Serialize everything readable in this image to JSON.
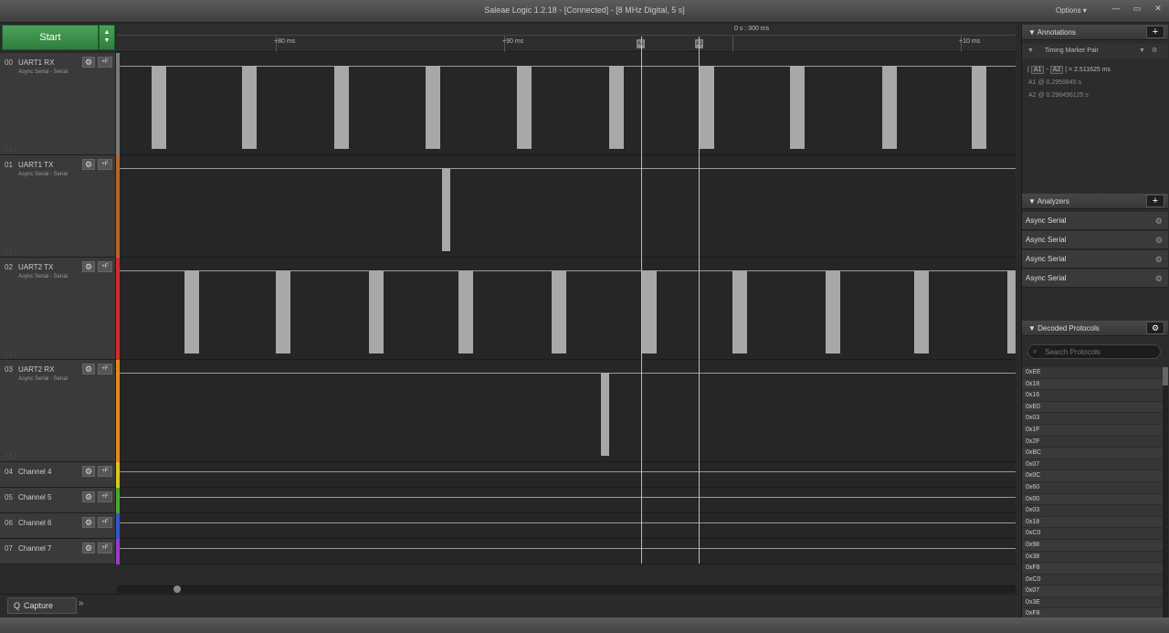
{
  "window": {
    "title": "Saleae Logic 1.2.18 - [Connected] - [8 MHz Digital, 5 s]",
    "options_label": "Options ▾",
    "minimize_glyph": "—",
    "restore_glyph": "▭",
    "close_glyph": "✕"
  },
  "toolbar": {
    "start_label": "Start",
    "arrows_glyph": "▲▼"
  },
  "ruler": {
    "absolute_time": "0 s : 300 ms",
    "ticks": [
      "+80 ms",
      "+90 ms",
      "+10 ms"
    ],
    "marker_a1": "A1",
    "marker_a2": "A2"
  },
  "channels": [
    {
      "num": "00",
      "name": "UART1 RX",
      "sub": "Async Serial - Serial",
      "color": "#7a7a7a"
    },
    {
      "num": "01",
      "name": "UART1 TX",
      "sub": "Async Serial - Serial",
      "color": "#b5652b"
    },
    {
      "num": "02",
      "name": "UART2 TX",
      "sub": "Async Serial - Serial",
      "color": "#d12b2b"
    },
    {
      "num": "03",
      "name": "UART2 RX",
      "sub": "Async Serial - Serial",
      "color": "#e08a1e"
    },
    {
      "num": "04",
      "name": "Channel 4",
      "sub": "",
      "color": "#d8c81e"
    },
    {
      "num": "05",
      "name": "Channel 5",
      "sub": "",
      "color": "#47a82f"
    },
    {
      "num": "06",
      "name": "Channel 6",
      "sub": "",
      "color": "#3358c9"
    },
    {
      "num": "07",
      "name": "Channel 7",
      "sub": "",
      "color": "#9a3bc4"
    }
  ],
  "channel_controls": {
    "gear_glyph": "⚙",
    "plus_glyph": "+F",
    "grip_glyph": "⋮⋮⋮"
  },
  "annotations": {
    "header": "Annotations",
    "add_glyph": "+",
    "filter_glyph": "▼",
    "marker_pair_label": "Timing Marker Pair",
    "dropdown_glyph": "▼",
    "gear_glyph": "⚙",
    "a1": "A1",
    "a2": "A2",
    "delta_prefix": "|",
    "delta_mid": "-",
    "delta_suffix": "| = 2.511625 ms",
    "a1_line": "A1  @  0.2959845 s",
    "a2_line": "A2  @  0.298496125 s"
  },
  "analyzers": {
    "header": "Analyzers",
    "add_glyph": "+",
    "gear_glyph": "⚙",
    "items": [
      "Async Serial",
      "Async Serial",
      "Async Serial",
      "Async Serial"
    ]
  },
  "decoded": {
    "header": "Decoded Protocols",
    "gear_glyph": "⚙",
    "search_icon": "⌕",
    "search_placeholder": "Search Protocols",
    "items": [
      "0xEE",
      "0x18",
      "0x16",
      "0xE0",
      "0x03",
      "0x1F",
      "0x2F",
      "0xBC",
      "0x07",
      "0x0C",
      "0x60",
      "0x00",
      "0x03",
      "0x18",
      "0xC0",
      "0x98",
      "0x38",
      "0xF8",
      "0xC0",
      "0x07",
      "0x3E",
      "0xF8"
    ]
  },
  "bottom": {
    "capture_label": "Capture",
    "capture_icon": "Q",
    "more_glyph": "»"
  }
}
